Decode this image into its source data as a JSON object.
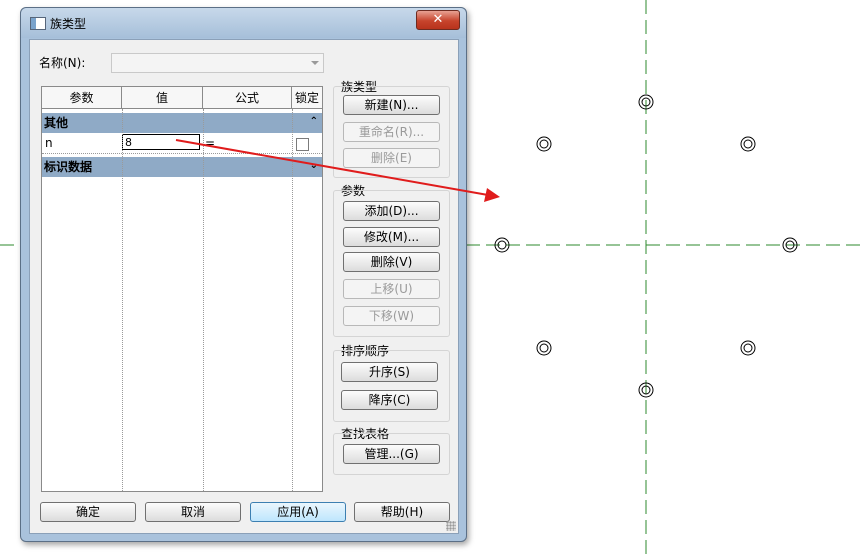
{
  "window": {
    "title": "族类型",
    "close_label": "✕"
  },
  "name_row": {
    "label": "名称(N):",
    "value": ""
  },
  "grid": {
    "columns": [
      "参数",
      "值",
      "公式",
      "锁定"
    ],
    "sections": [
      {
        "title": "其他",
        "chevron": "⌃",
        "rows": [
          {
            "param": "n",
            "value": "8",
            "formula": "=",
            "locked": false
          }
        ]
      },
      {
        "title": "标识数据",
        "chevron": "⌄"
      }
    ]
  },
  "groups": {
    "family_types": {
      "title": "族类型",
      "new": "新建(N)...",
      "rename": "重命名(R)...",
      "delete": "删除(E)"
    },
    "parameters": {
      "title": "参数",
      "add": "添加(D)...",
      "modify": "修改(M)...",
      "delete": "删除(V)",
      "move_up": "上移(U)",
      "move_down": "下移(W)"
    },
    "sort_order": {
      "title": "排序顺序",
      "ascending": "升序(S)",
      "descending": "降序(C)"
    },
    "lookup_tables": {
      "title": "查找表格",
      "manage": "管理...(G)"
    }
  },
  "footer": {
    "ok": "确定",
    "cancel": "取消",
    "apply": "应用(A)",
    "help": "帮助(H)"
  },
  "colors": {
    "reference_line": "#2d8a2d",
    "arrow": "#e01c1c",
    "section_header": "#8faac6"
  }
}
